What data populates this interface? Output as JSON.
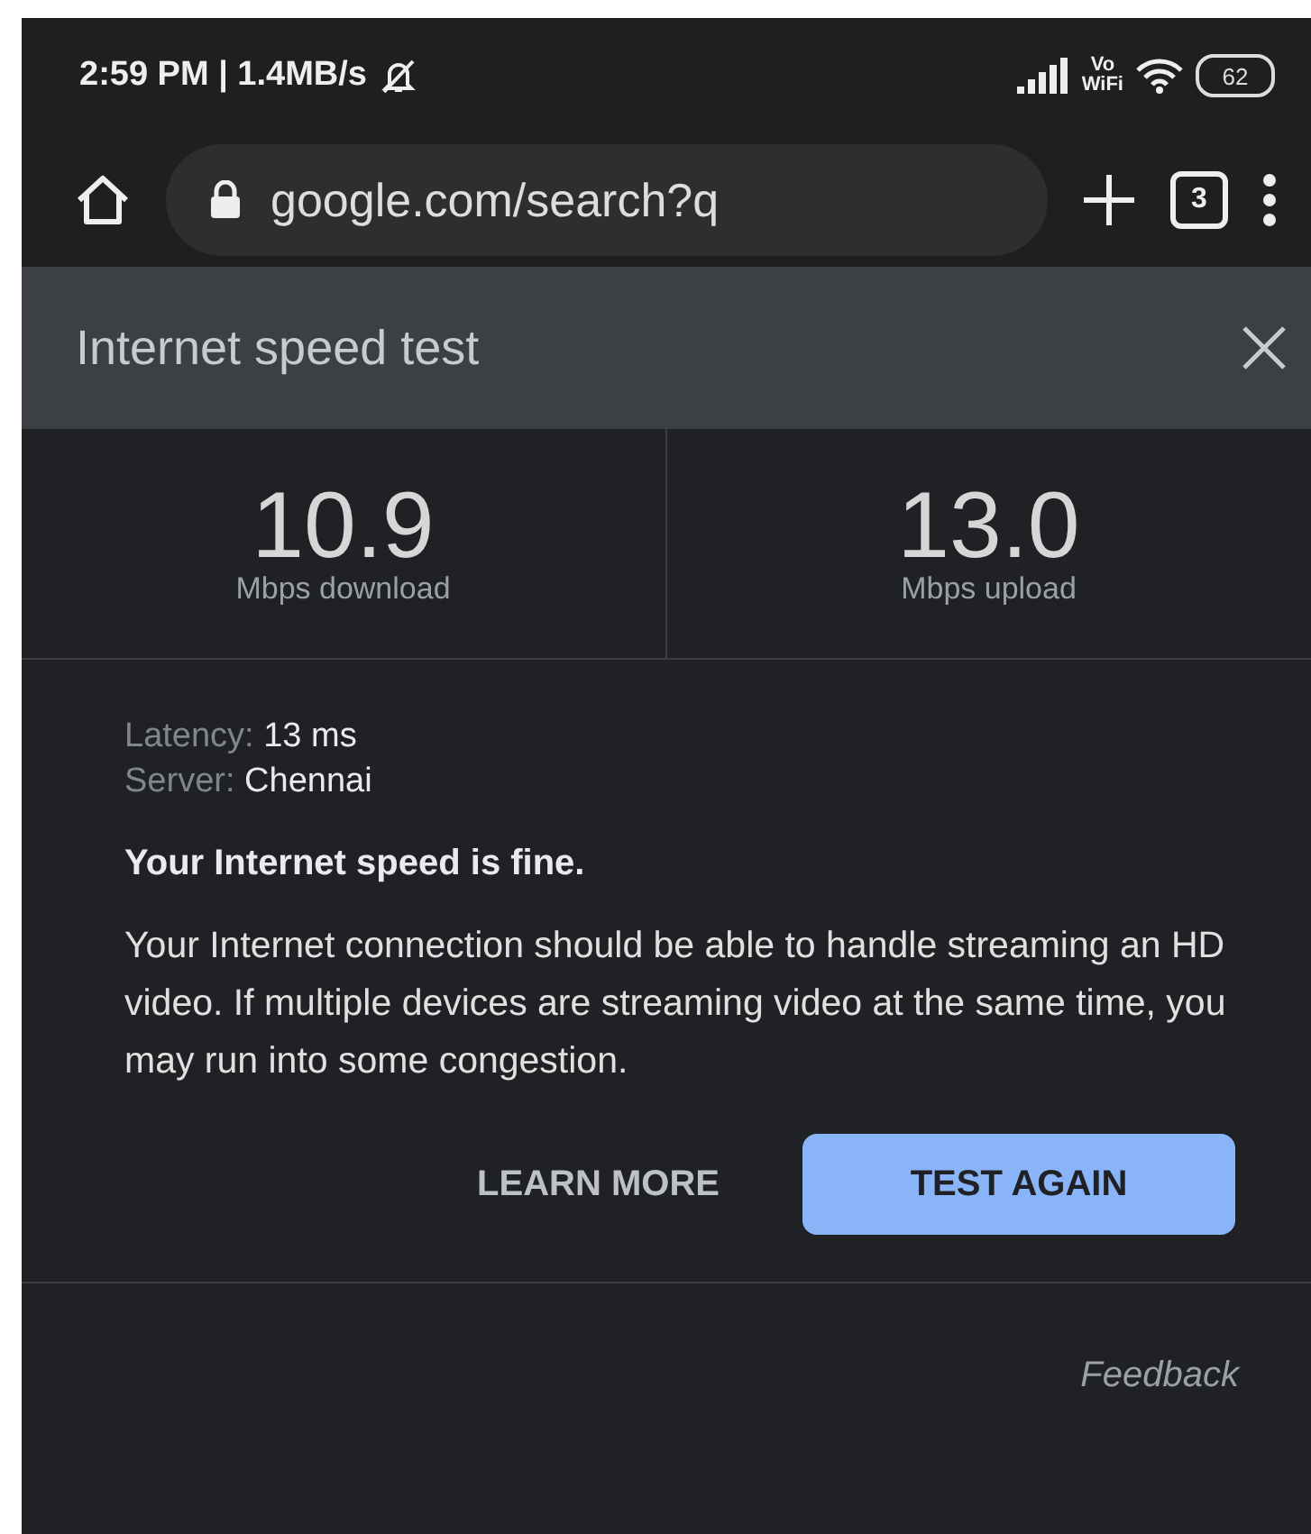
{
  "status_bar": {
    "time": "2:59 PM | 1.4MB/s",
    "vo": "Vo",
    "wifi": "WiFi",
    "battery": "62"
  },
  "toolbar": {
    "url": "google.com/search?q",
    "tab_count": "3"
  },
  "card": {
    "title": "Internet speed test",
    "results": [
      {
        "value": "10.9",
        "label": "Mbps download"
      },
      {
        "value": "13.0",
        "label": "Mbps upload"
      }
    ],
    "details": [
      {
        "label": "Latency:",
        "value": "13 ms"
      },
      {
        "label": "Server:",
        "value": "Chennai"
      }
    ],
    "verdict": "Your Internet speed is fine.",
    "description": "Your Internet connection should be able to handle streaming an HD video. If multiple devices are streaming video at the same time, you may run into some congestion.",
    "learn_more": "LEARN MORE",
    "test_again": "TEST AGAIN",
    "feedback": "Feedback"
  }
}
